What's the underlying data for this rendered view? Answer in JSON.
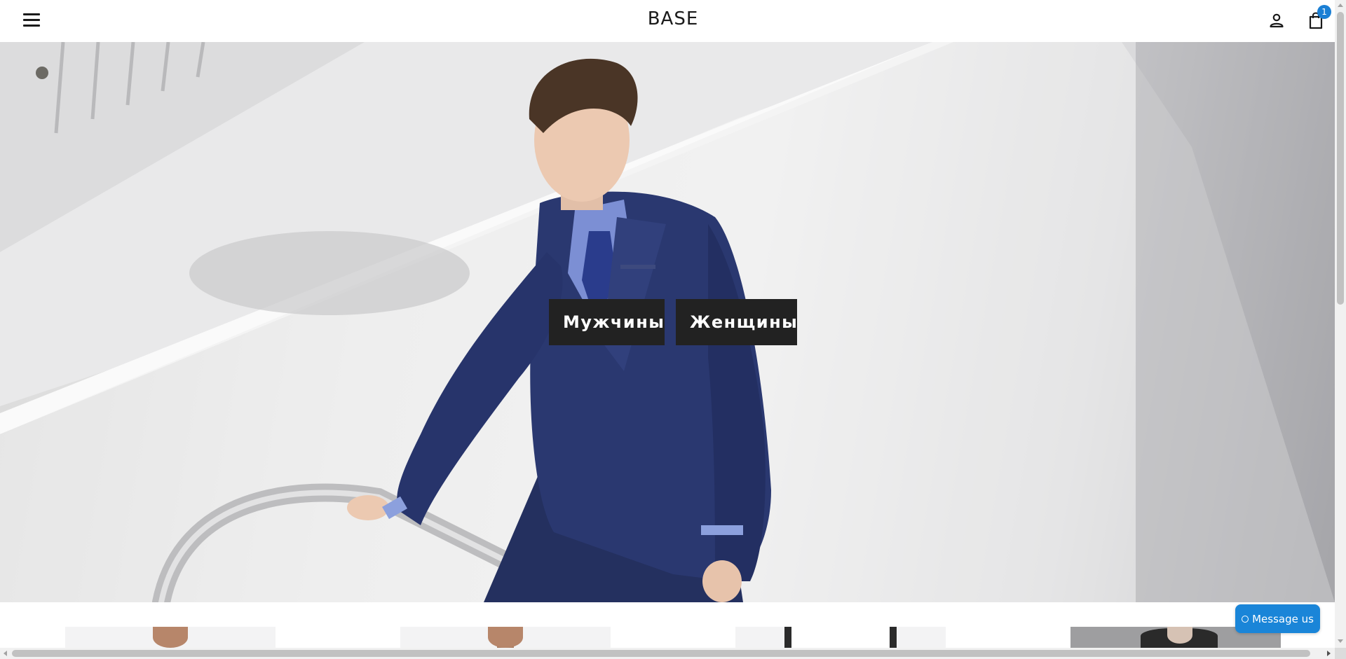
{
  "header": {
    "logo": "BASE",
    "menu_icon": "hamburger-menu-icon",
    "account_icon": "user-icon",
    "cart_icon": "shopping-bag-icon",
    "cart_count": "1"
  },
  "hero": {
    "image": "man-in-navy-suit-on-staircase",
    "buttons": [
      "Мужчины",
      "Женщины"
    ]
  },
  "products": {
    "items": [
      "product-1",
      "product-2",
      "product-3",
      "product-4"
    ]
  },
  "chat": {
    "label": "Message us",
    "icon": "chat-ring-icon"
  },
  "colors": {
    "accent": "#1a85d8",
    "button_bg": "#222222",
    "suit": "#27346b"
  }
}
